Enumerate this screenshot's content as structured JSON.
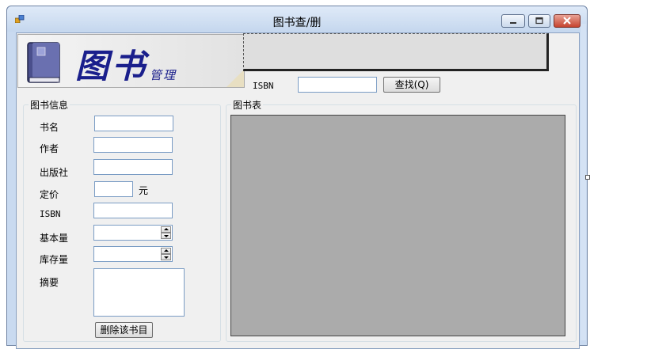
{
  "window": {
    "title": "图书查/删",
    "controls": [
      "minimize",
      "maximize",
      "close"
    ]
  },
  "banner": {
    "title": "图书",
    "subtitle": "管理",
    "icon": "book-icon"
  },
  "search": {
    "isbn_label": "ISBN",
    "isbn_value": "",
    "find_button": "查找(Q)"
  },
  "info_group": {
    "title": "图书信息",
    "fields": {
      "name_label": "书名",
      "author_label": "作者",
      "publisher_label": "出版社",
      "price_label": "定价",
      "price_unit": "元",
      "isbn_label": "ISBN",
      "base_qty_label": "基本量",
      "stock_qty_label": "库存量",
      "summary_label": "摘要"
    },
    "delete_button": "删除该书目"
  },
  "table_group": {
    "title": "图书表"
  },
  "colors": {
    "window_frame": "#c9daf0",
    "client_bg": "#f0f0f0",
    "grid_bg": "#ababab",
    "banner_text": "#1a1f8c",
    "close_button": "#c5432f"
  }
}
